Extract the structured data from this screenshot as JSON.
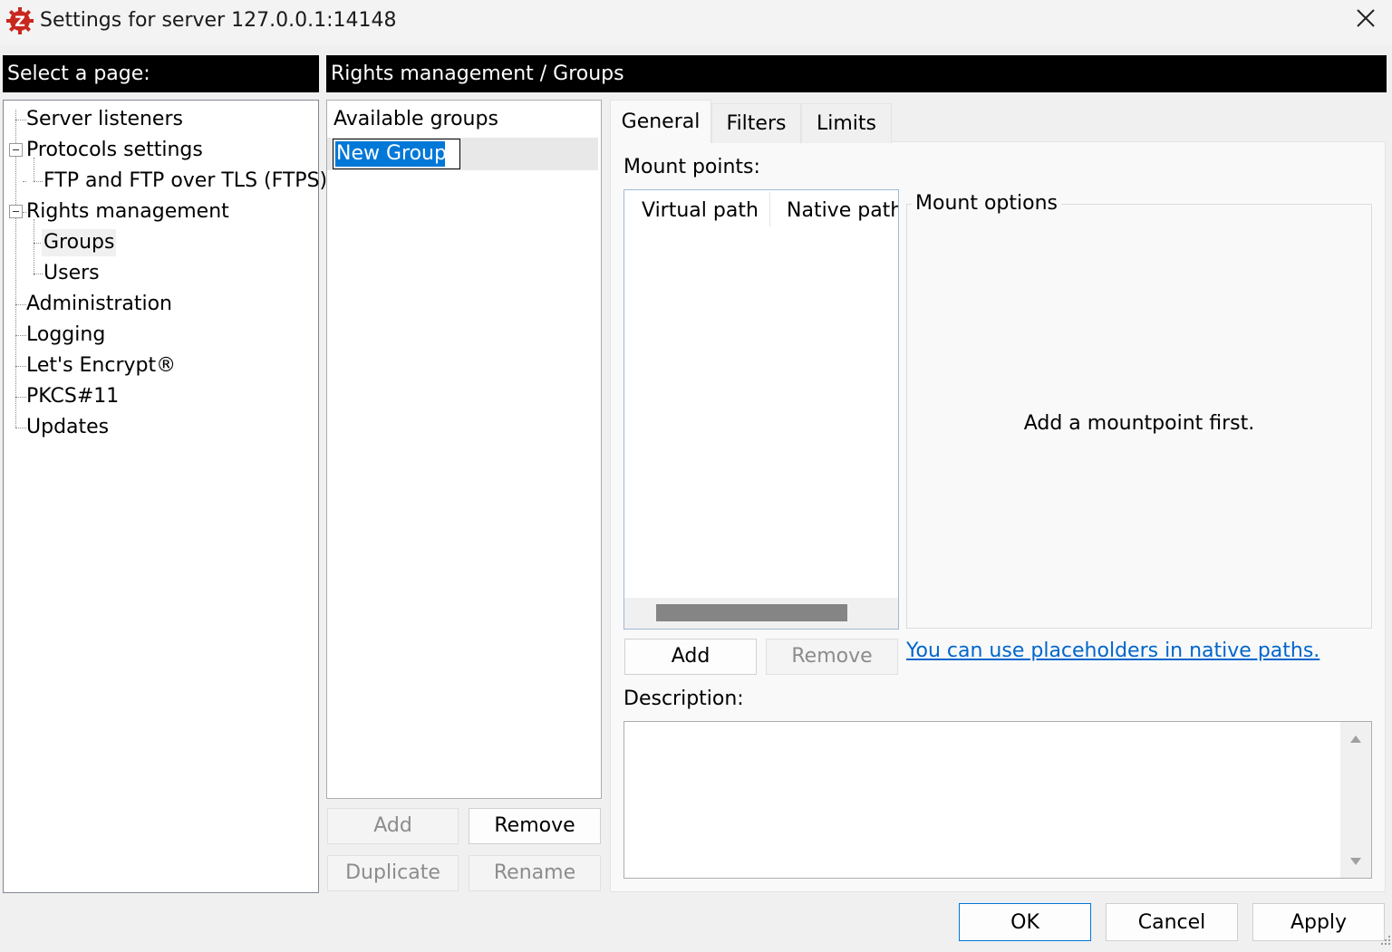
{
  "window": {
    "title": "Settings for server 127.0.0.1:14148"
  },
  "left_header": "Select a page:",
  "right_header": "Rights management / Groups",
  "tree": {
    "server_listeners": "Server listeners",
    "protocols_settings": "Protocols settings",
    "ftp_ftps": "FTP and FTP over TLS (FTPS)",
    "rights_management": "Rights management",
    "groups": "Groups",
    "users": "Users",
    "administration": "Administration",
    "logging": "Logging",
    "lets_encrypt": "Let's Encrypt®",
    "pkcs11": "PKCS#11",
    "updates": "Updates"
  },
  "groups_panel": {
    "header": "Available groups",
    "editing_value": "New Group",
    "add": "Add",
    "remove": "Remove",
    "duplicate": "Duplicate",
    "rename": "Rename"
  },
  "tabs": {
    "general": "General",
    "filters": "Filters",
    "limits": "Limits"
  },
  "general": {
    "mount_points_label": "Mount points:",
    "col_virtual_path": "Virtual path",
    "col_native_path": "Native path",
    "mount_options_label": "Mount options",
    "mount_options_empty": "Add a mountpoint first.",
    "add": "Add",
    "remove": "Remove",
    "placeholders_link": "You can use placeholders in native paths.",
    "description_label": "Description:",
    "description_value": ""
  },
  "footer": {
    "ok": "OK",
    "cancel": "Cancel",
    "apply": "Apply"
  },
  "colors": {
    "accent": "#0078d7",
    "link": "#0066cc",
    "header_bg": "#000000",
    "icon_red": "#c8281e"
  }
}
